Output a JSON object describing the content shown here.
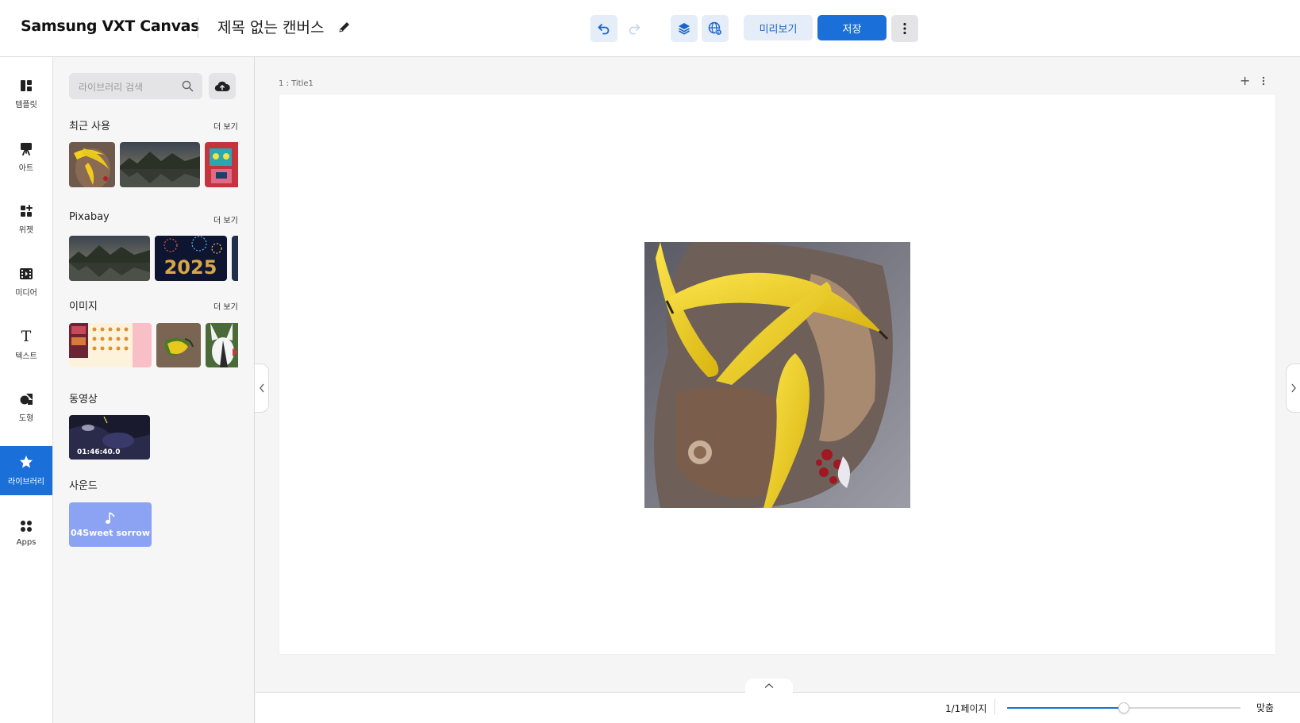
{
  "app": {
    "brand": "Samsung VXT Canvas",
    "doc_title": "제목 없는 캔버스"
  },
  "toolbar": {
    "preview_label": "미리보기",
    "save_label": "저장"
  },
  "nav": {
    "items": [
      {
        "label": "템플릿",
        "icon": "template-icon"
      },
      {
        "label": "아트",
        "icon": "art-easel-icon"
      },
      {
        "label": "위젯",
        "icon": "widget-icon"
      },
      {
        "label": "미디어",
        "icon": "media-icon"
      },
      {
        "label": "텍스트",
        "icon": "text-icon"
      },
      {
        "label": "도형",
        "icon": "shape-icon"
      },
      {
        "label": "라이브러리",
        "icon": "star-icon",
        "active": true
      },
      {
        "label": "Apps",
        "icon": "apps-icon"
      }
    ]
  },
  "library": {
    "search_placeholder": "라이브러리 검색",
    "sections": {
      "recent": {
        "title": "최근 사용",
        "more": "더 보기"
      },
      "pixabay": {
        "title": "Pixabay",
        "more": "더 보기"
      },
      "images": {
        "title": "이미지",
        "more": "더 보기"
      },
      "video": {
        "title": "동영상",
        "duration": "01:46:40.0"
      },
      "sound": {
        "title": "사운드",
        "track_name": "04Sweet sorrow"
      }
    }
  },
  "canvas": {
    "page_label": "1 : Title1"
  },
  "bottom": {
    "page_count": "1/1페이지",
    "fit_label": "맞춤",
    "zoom_fraction": 0.5
  },
  "colors": {
    "accent": "#1a70d8",
    "accent_light": "#e5edf8",
    "sound_card": "#8ba3f2"
  }
}
